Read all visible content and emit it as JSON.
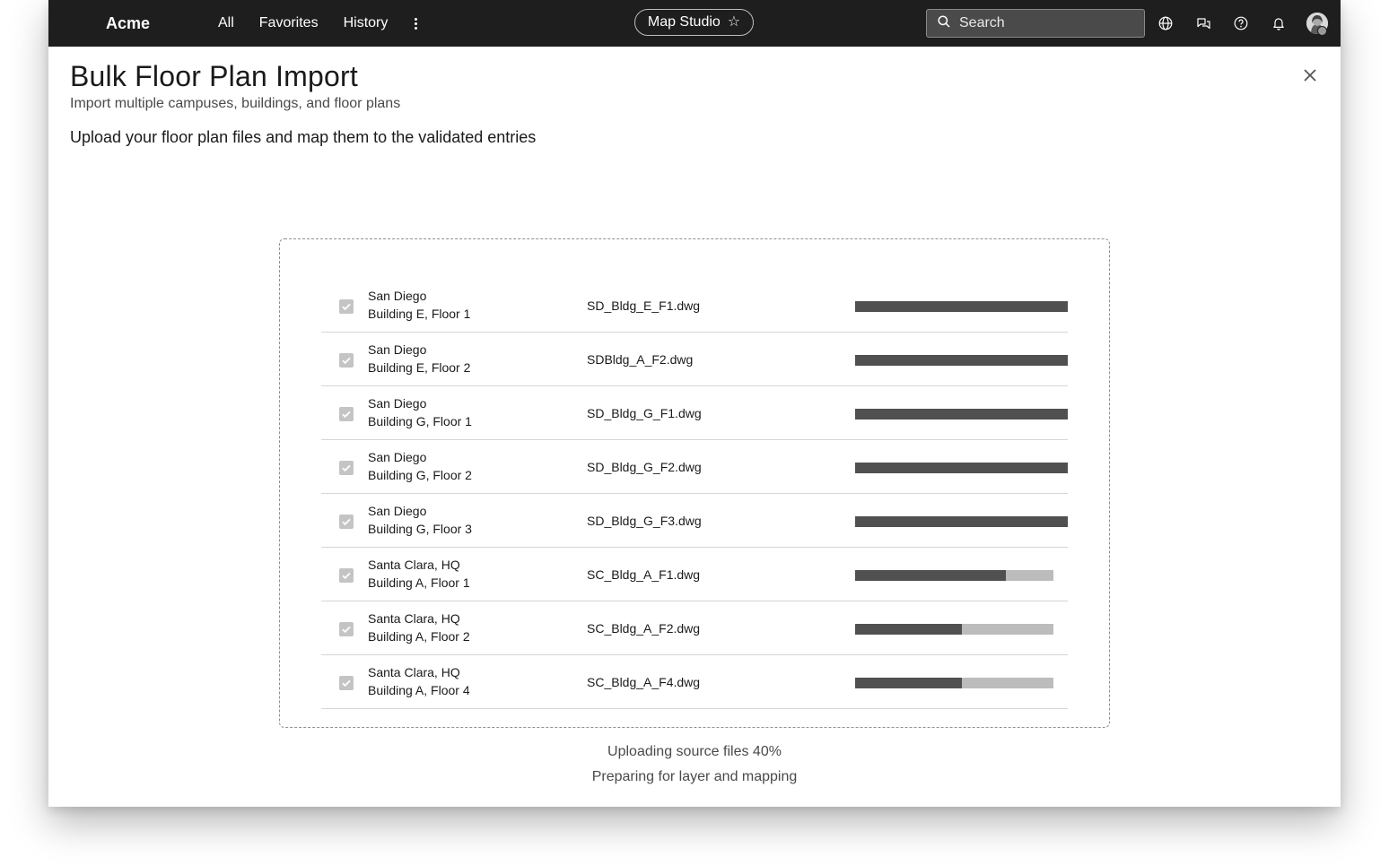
{
  "topbar": {
    "brand": "Acme",
    "nav": [
      "All",
      "Favorites",
      "History"
    ],
    "app_name": "Map Studio",
    "search_placeholder": "Search",
    "background": "#1e1e1e"
  },
  "dialog": {
    "title": "Bulk Floor Plan Import",
    "subtitle": "Import multiple campuses, buildings, and floor plans",
    "instructions": "Upload your floor plan files and map them to the validated entries"
  },
  "files": [
    {
      "checked": true,
      "campus": "San Diego",
      "location": "Building E, Floor 1",
      "file": "SD_Bldg_E_F1.dwg",
      "progress": 1.0
    },
    {
      "checked": true,
      "campus": "San Diego",
      "location": "Building E, Floor 2",
      "file": "SDBldg_A_F2.dwg",
      "progress": 1.0
    },
    {
      "checked": true,
      "campus": "San Diego",
      "location": "Building G, Floor 1",
      "file": "SD_Bldg_G_F1.dwg",
      "progress": 1.0
    },
    {
      "checked": true,
      "campus": "San Diego",
      "location": "Building G, Floor 2",
      "file": "SD_Bldg_G_F2.dwg",
      "progress": 1.0
    },
    {
      "checked": true,
      "campus": "San Diego",
      "location": "Building G, Floor 3",
      "file": "SD_Bldg_G_F3.dwg",
      "progress": 1.0
    },
    {
      "checked": true,
      "campus": "Santa Clara, HQ",
      "location": "Building A, Floor 1",
      "file": "SC_Bldg_A_F1.dwg",
      "progress": 0.76
    },
    {
      "checked": true,
      "campus": "Santa Clara, HQ",
      "location": "Building A, Floor 2",
      "file": "SC_Bldg_A_F2.dwg",
      "progress": 0.54
    },
    {
      "checked": true,
      "campus": "Santa Clara, HQ",
      "location": "Building A, Floor 4",
      "file": "SC_Bldg_A_F4.dwg",
      "progress": 0.54
    }
  ],
  "status": {
    "upload": "Uploading source files 40%",
    "next": "Preparing for layer and mapping"
  },
  "colors": {
    "progress_fill": "#505050",
    "progress_track": "#bcbcbc",
    "checkbox": "#c4c4c4"
  }
}
